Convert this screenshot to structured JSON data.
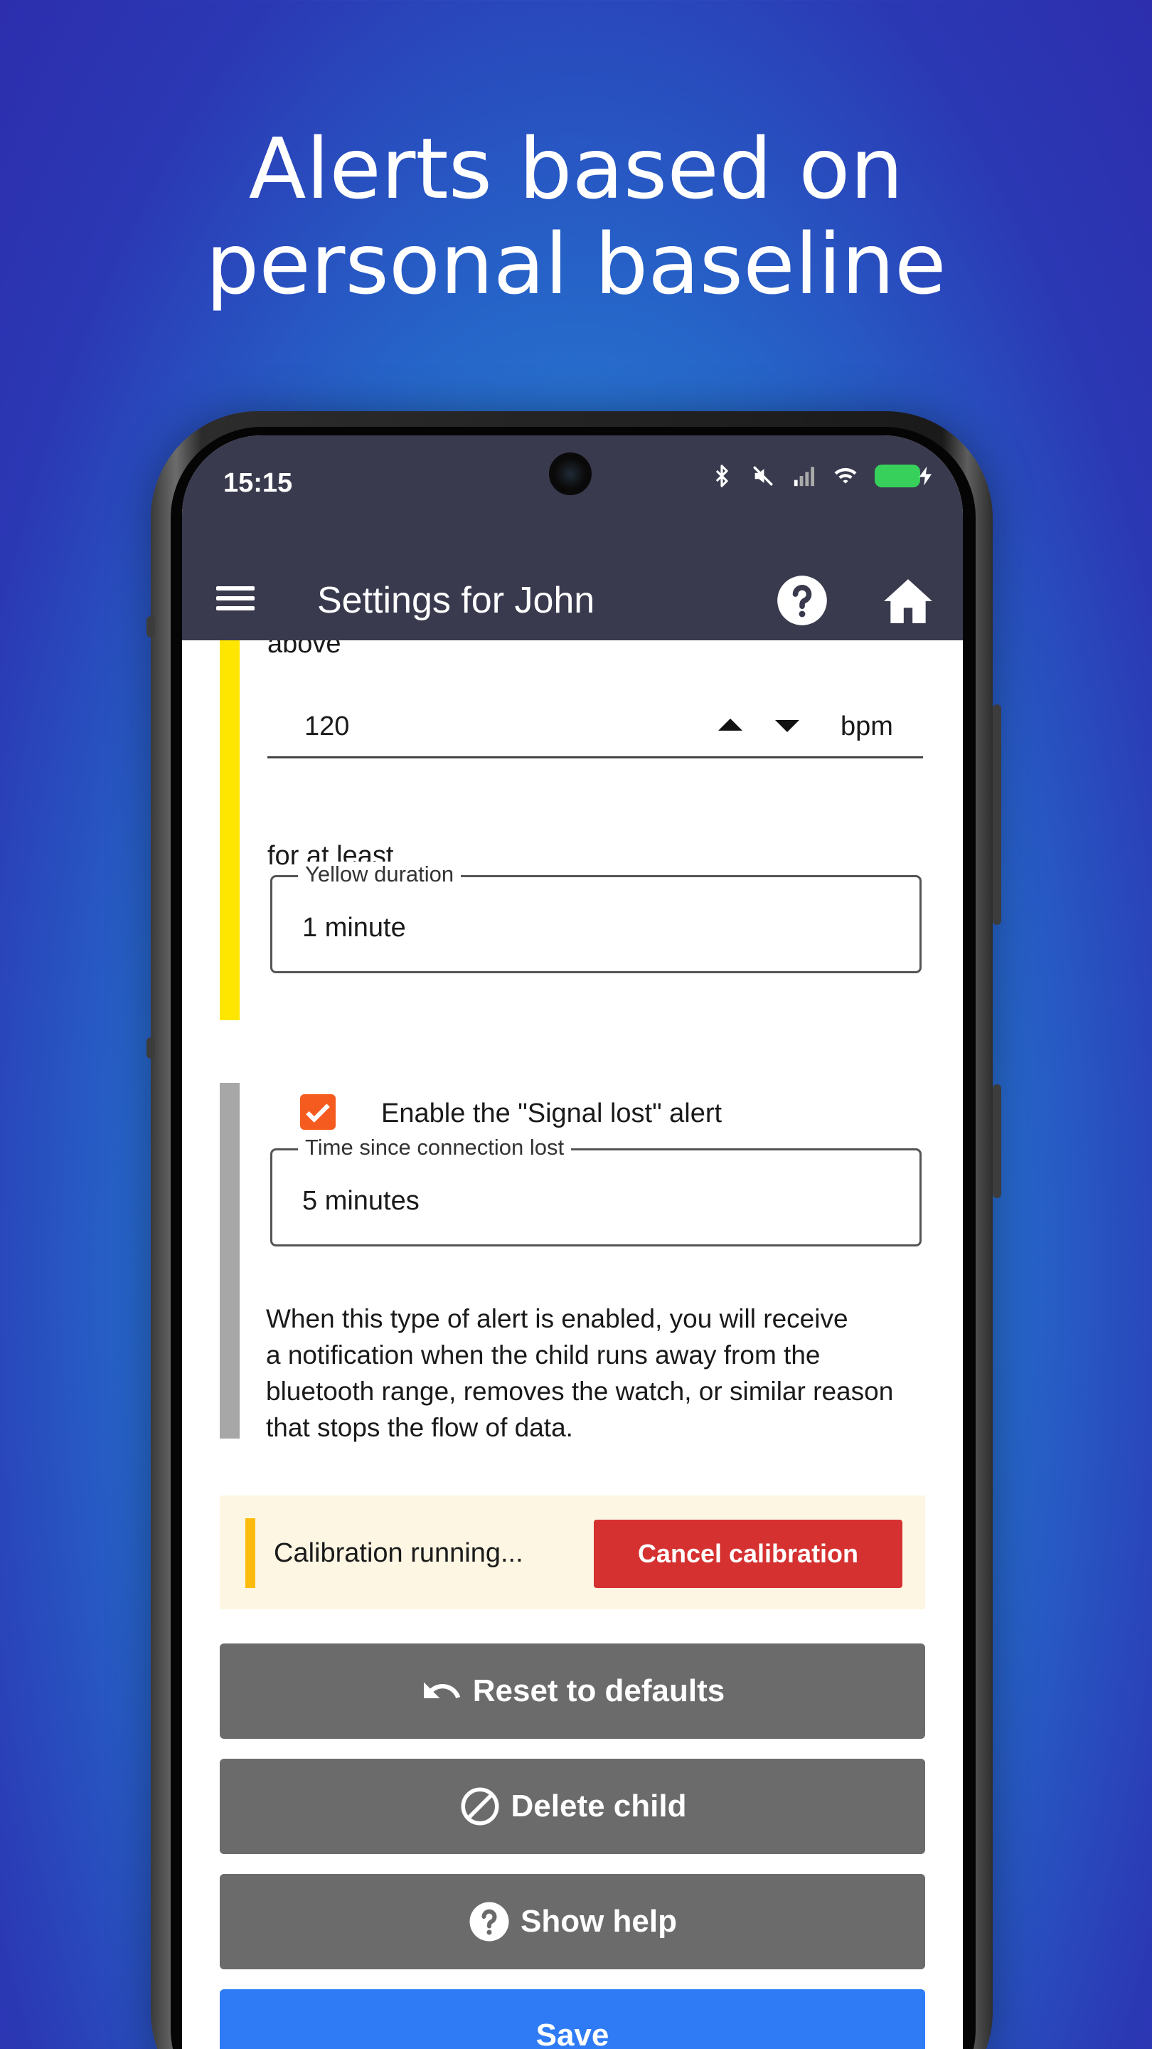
{
  "headline": {
    "line1": "Alerts based on",
    "line2": "personal baseline"
  },
  "status_bar": {
    "time": "15:15",
    "icons": [
      "bluetooth-icon",
      "mute-icon",
      "signal-icon",
      "wifi-icon",
      "battery-charging-icon"
    ],
    "battery_color": "#37d05a"
  },
  "app_bar": {
    "title": "Settings for John",
    "icons": [
      "menu-icon",
      "help-icon",
      "home-icon"
    ]
  },
  "yellow_alert": {
    "above_label": "above",
    "heart_rate_value": "120",
    "heart_rate_unit": "bpm",
    "duration_label": "for at least",
    "duration_field_label": "Yellow duration",
    "duration_value": "1 minute",
    "accent_color": "#ffe600"
  },
  "signal_lost": {
    "checkbox_label": "Enable the \"Signal lost\" alert",
    "checked": true,
    "field_label": "Time since connection lost",
    "field_value": "5 minutes",
    "description": [
      "When this type of alert is enabled, you will receive",
      "a notification when the child runs away from the",
      "bluetooth range, removes the watch, or similar reason",
      "that stops the flow of data."
    ],
    "accent_color": "#a7a7a7"
  },
  "calibration": {
    "status": "Calibration running...",
    "cancel_label": "Cancel calibration",
    "cancel_color": "#d63131"
  },
  "actions": {
    "reset_label": "Reset to defaults",
    "delete_label": "Delete child",
    "help_label": "Show help",
    "save_label": "Save",
    "save_color": "#2f7bf5"
  }
}
